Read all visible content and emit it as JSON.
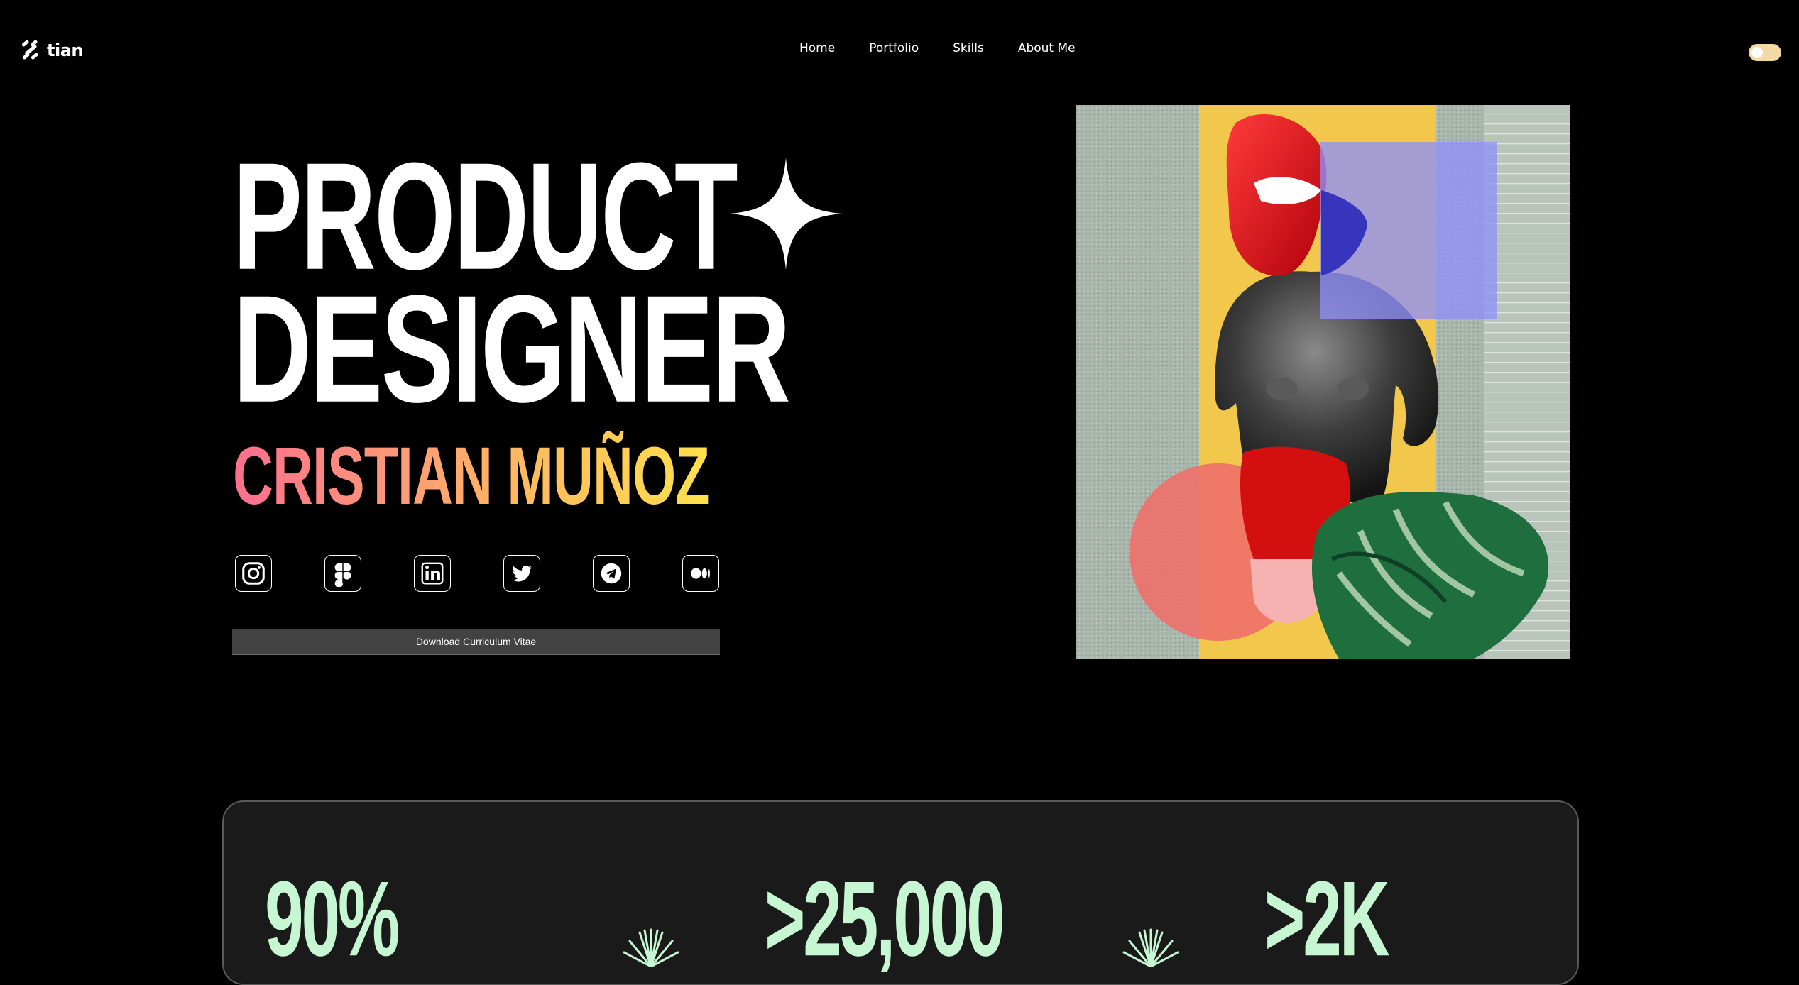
{
  "header": {
    "logo_text": "tian",
    "logo_icon": "logo-mark-icon",
    "nav": [
      "Home",
      "Portfolio",
      "Skills",
      "About Me"
    ],
    "theme_toggle": "theme-toggle"
  },
  "hero": {
    "line1": "PRODUCT",
    "line2": "DESIGNER",
    "name": "CRISTIAN MUÑOZ",
    "name_gradient": [
      "#ff6f8e",
      "#ff9a76",
      "#ffbe5c",
      "#ffe14d"
    ],
    "socials": [
      "instagram-icon",
      "figma-icon",
      "linkedin-icon",
      "twitter-icon",
      "telegram-icon",
      "medium-icon"
    ],
    "cv_button": "Download Curriculum Vitae"
  },
  "stats": {
    "values": [
      "90%",
      ">25,000",
      ">2K"
    ],
    "value_color": "#c6f7d2"
  },
  "colors": {
    "background": "#000000",
    "card": "#1a1a1a",
    "button": "#424242",
    "toggle": "#f3d9a4"
  }
}
